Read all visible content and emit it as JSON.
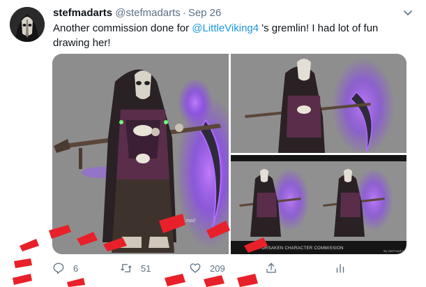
{
  "tweet": {
    "display_name": "stefmadarts",
    "handle": "@stefmadarts",
    "separator": "·",
    "date": "Sep 26",
    "text_before": "Another commission done for ",
    "mention": "@LittleViking4",
    "text_after": " 's gremlin! I had lot of fun drawing her!"
  },
  "media": {
    "caption": "FORSAKEN CHARACTER COMMISSION",
    "credit": "By Stef-mad-a",
    "signature": "stef mad"
  },
  "actions": {
    "reply_icon": "reply-icon",
    "reply_count": "6",
    "retweet_icon": "retweet-icon",
    "retweet_count": "51",
    "like_icon": "heart-icon",
    "like_count": "209",
    "share_icon": "share-icon",
    "analytics_icon": "analytics-icon"
  },
  "colors": {
    "mention": "#1b95e0",
    "secondary_text": "#5b7083",
    "purple_glow": "#8a3cff",
    "paint_strokes": "#e8202a"
  }
}
